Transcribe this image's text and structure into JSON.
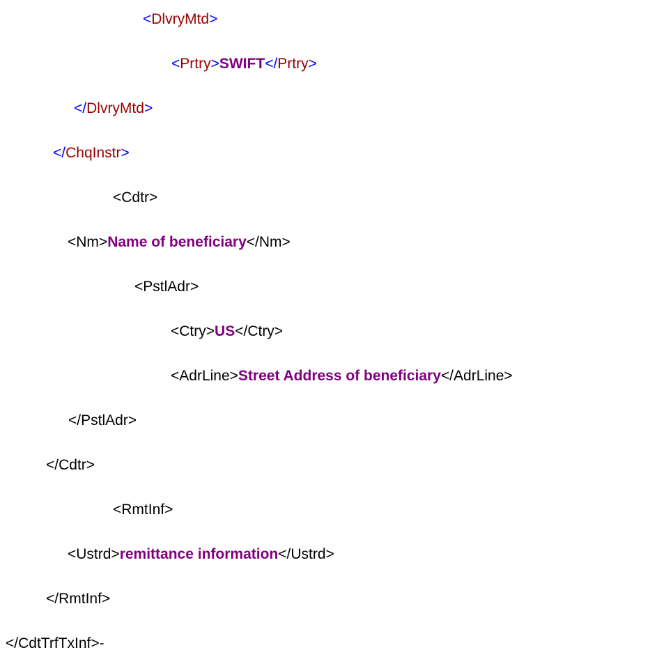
{
  "lines": [
    {
      "open": "<",
      "open_name": "DlvryMtd",
      "close": ">"
    },
    {
      "open": "<",
      "open_name": "Prtry",
      "open_end": ">",
      "value": "SWIFT",
      "close": "</",
      "close_name": "Prtry",
      "close_end": ">"
    },
    {
      "open": "</",
      "open_name": "DlvryMtd",
      "close": ">"
    },
    {
      "open": "</",
      "open_name": "ChqInstr",
      "close": ">"
    },
    {
      "text": "<Cdtr>"
    },
    {
      "prefix": "<Nm>",
      "value": "Name of beneficiary",
      "suffix": "</Nm>"
    },
    {
      "text": "<PstlAdr>"
    },
    {
      "prefix": "<Ctry>",
      "value": "US",
      "suffix": "</Ctry>"
    },
    {
      "prefix": "<AdrLine>",
      "value": "Street Address of beneficiary",
      "suffix": "</AdrLine>"
    },
    {
      "text": "</PstlAdr>"
    },
    {
      "text": "</Cdtr>"
    },
    {
      "text": "<RmtInf>"
    },
    {
      "prefix": "<Ustrd>",
      "value": "remittance information",
      "suffix": "</Ustrd>"
    },
    {
      "text": "</RmtInf>"
    },
    {
      "text": "</CdtTrfTxInf>-"
    }
  ],
  "colors": {
    "bracket": "#0000ff",
    "tag_name": "#990000",
    "plain": "#000000",
    "value": "#800080"
  }
}
